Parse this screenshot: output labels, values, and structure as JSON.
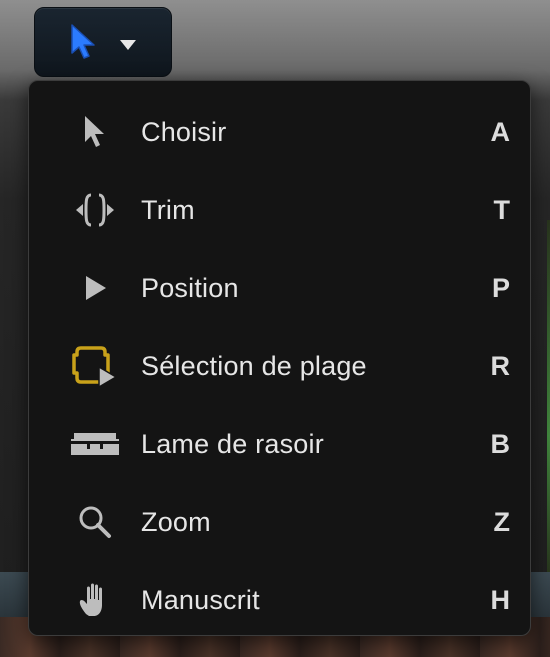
{
  "toolbar": {
    "select_tool_icon": "arrow-pointer-icon",
    "dropdown_icon": "caret-down-icon",
    "accent_color": "#2b7bff"
  },
  "menu": {
    "items": [
      {
        "label": "Choisir",
        "shortcut": "A",
        "icon": "arrow-icon"
      },
      {
        "label": "Trim",
        "shortcut": "T",
        "icon": "trim-icon"
      },
      {
        "label": "Position",
        "shortcut": "P",
        "icon": "position-icon"
      },
      {
        "label": "Sélection de plage",
        "shortcut": "R",
        "icon": "range-selection-icon"
      },
      {
        "label": "Lame de rasoir",
        "shortcut": "B",
        "icon": "blade-icon"
      },
      {
        "label": "Zoom",
        "shortcut": "Z",
        "icon": "zoom-icon"
      },
      {
        "label": "Manuscrit",
        "shortcut": "H",
        "icon": "hand-icon"
      }
    ]
  }
}
